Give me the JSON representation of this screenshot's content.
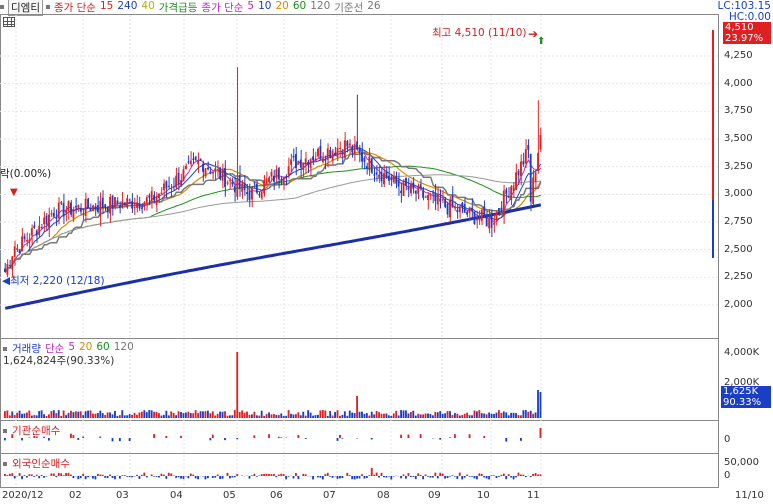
{
  "legend": {
    "stock_name": "디엠티",
    "items": [
      {
        "label": "종가 단순",
        "color": "#d61f1f"
      },
      {
        "label": "15",
        "color": "#d61f1f"
      },
      {
        "label": "240",
        "color": "#1a3fc4"
      },
      {
        "label": "40",
        "color": "#b7b100"
      },
      {
        "label": "가격급등",
        "color": "#1a8f1a"
      },
      {
        "label": "종가 단순",
        "color": "#c02bc0"
      },
      {
        "label": "5",
        "color": "#c02bc0"
      },
      {
        "label": "10",
        "color": "#1a3fc4"
      },
      {
        "label": "20",
        "color": "#e08a00"
      },
      {
        "label": "60",
        "color": "#1a8f1a"
      },
      {
        "label": "120",
        "color": "#777777"
      },
      {
        "label": "기준선",
        "color": "#777777"
      },
      {
        "label": "26",
        "color": "#777777"
      }
    ]
  },
  "top_right": {
    "lc": "LC:103.15",
    "hc": "HC:0.00",
    "price_badge": "4,510",
    "pct_badge": "23.97%"
  },
  "annotations": {
    "high": "최고 4,510 (11/10)",
    "low": "최저 2,220 (12/18)",
    "left_cut": "락(0.00%)"
  },
  "price_axis": [
    "4,250",
    "4,000",
    "3,750",
    "3,500",
    "3,250",
    "3,000",
    "2,750",
    "2,500",
    "2,250",
    "2,000"
  ],
  "volume_panel": {
    "items": [
      {
        "label": "거래량",
        "color": "#1a3fc4"
      },
      {
        "label": "단순",
        "color": "#c02bc0"
      },
      {
        "label": "5",
        "color": "#c02bc0"
      },
      {
        "label": "20",
        "color": "#e08a00"
      },
      {
        "label": "60",
        "color": "#1a8f1a"
      },
      {
        "label": "120",
        "color": "#777777"
      }
    ],
    "value": "1,624,824주(90.33%)",
    "axis": [
      "4,000K",
      "2,000K"
    ],
    "badge_value": "1,625K",
    "badge_pct": "90.33%"
  },
  "inst_panel": {
    "label": "기관순매수",
    "axis": [
      "0"
    ]
  },
  "foreign_panel": {
    "label": "외국인순매수",
    "axis": [
      "50,000",
      "0"
    ]
  },
  "x_axis": [
    "2020/12",
    "02",
    "03",
    "04",
    "05",
    "06",
    "07",
    "08",
    "09",
    "10",
    "11"
  ],
  "x_axis_right": "11/10",
  "colors": {
    "up": "#e02020",
    "down": "#1a3fc4",
    "ma240": "#1a2fa8",
    "ichimoku": "#777777"
  },
  "chart_data": {
    "type": "candlestick",
    "period": "2020/12 – 2021/11/10",
    "price_ylim": [
      1900,
      4600
    ],
    "ticks": [
      2000,
      2250,
      2500,
      2750,
      3000,
      3250,
      3500,
      3750,
      4000,
      4250
    ],
    "high": 4510,
    "low": 2220,
    "monthly_closes_approx": [
      {
        "month": "2020/12",
        "close": 2400
      },
      {
        "month": "01",
        "close": 2850
      },
      {
        "month": "02",
        "close": 2900
      },
      {
        "month": "03",
        "close": 2950
      },
      {
        "month": "04",
        "close": 3300
      },
      {
        "month": "05",
        "close": 3000
      },
      {
        "month": "06",
        "close": 3300
      },
      {
        "month": "07",
        "close": 3450
      },
      {
        "month": "08",
        "close": 3100
      },
      {
        "month": "09",
        "close": 2900
      },
      {
        "month": "10",
        "close": 2750
      },
      {
        "month": "11",
        "close": 3600
      }
    ]
  }
}
